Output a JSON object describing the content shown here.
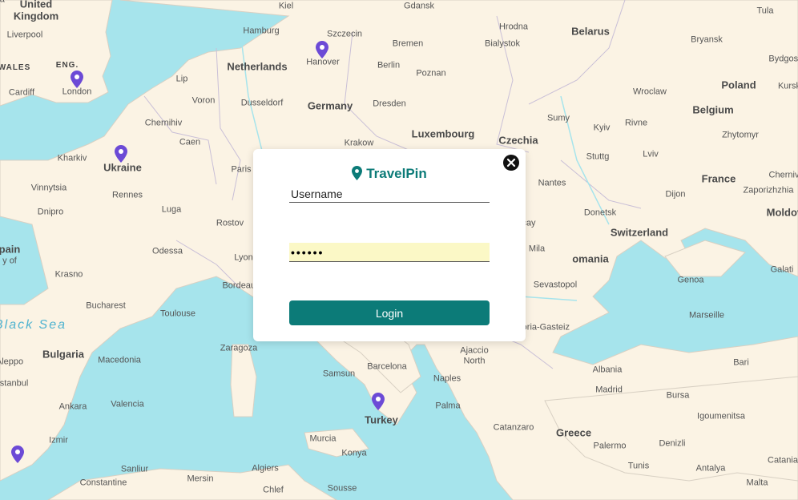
{
  "app": {
    "brand": "TravelPin",
    "accent": "#0c7b78",
    "pin_color": "#6c4ad6"
  },
  "login": {
    "username_placeholder": "Username",
    "password_value": "••••••",
    "login_label": "Login"
  },
  "map": {
    "labels": [
      {
        "t": "United",
        "k": "country"
      },
      {
        "t": "Kingdom",
        "k": "country"
      },
      {
        "t": "Liverpool"
      },
      {
        "t": "WALES",
        "k": "small"
      },
      {
        "t": "ENG.",
        "k": "small"
      },
      {
        "t": "Cardiff"
      },
      {
        "t": "London"
      },
      {
        "t": "Kiel"
      },
      {
        "t": "Gdansk"
      },
      {
        "t": "Tula"
      },
      {
        "t": "Hrodna"
      },
      {
        "t": "Belarus",
        "k": "country"
      },
      {
        "t": "Hamburg"
      },
      {
        "t": "Szczecin"
      },
      {
        "t": "Bialystok"
      },
      {
        "t": "Bryansk"
      },
      {
        "t": "Bremen"
      },
      {
        "t": "Bydgoszcz"
      },
      {
        "t": "Lip"
      },
      {
        "t": "Netherlands",
        "k": "country"
      },
      {
        "t": "Hanover"
      },
      {
        "t": "Berlin"
      },
      {
        "t": "Poznan"
      },
      {
        "t": "Poland",
        "k": "country"
      },
      {
        "t": "Kursk"
      },
      {
        "t": "Voron"
      },
      {
        "t": "Dusseldorf"
      },
      {
        "t": "Germany",
        "k": "country"
      },
      {
        "t": "Dresden"
      },
      {
        "t": "Wroclaw"
      },
      {
        "t": "Chernihiv"
      },
      {
        "t": "Belgium",
        "k": "country"
      },
      {
        "t": "Sumy"
      },
      {
        "t": "Rivne"
      },
      {
        "t": "Kyiv"
      },
      {
        "t": "Zhytomyr"
      },
      {
        "t": "Kharkiv"
      },
      {
        "t": "Caen"
      },
      {
        "t": "Luxembourg",
        "k": "country"
      },
      {
        "t": "Krakow"
      },
      {
        "t": "Czechia",
        "k": "country"
      },
      {
        "t": "Lviv"
      },
      {
        "t": "Ukraine",
        "k": "country"
      },
      {
        "t": "Paris"
      },
      {
        "t": "Stuttg"
      },
      {
        "t": "Vinnytsia"
      },
      {
        "t": "Rennes"
      },
      {
        "t": "France",
        "k": "country"
      },
      {
        "t": "Chernivtsi"
      },
      {
        "t": "Dnipro"
      },
      {
        "t": "Luga"
      },
      {
        "t": "Nantes"
      },
      {
        "t": "Dijon"
      },
      {
        "t": "Zaporizhzhia"
      },
      {
        "t": "Donetsk"
      },
      {
        "t": "Moldova",
        "k": "country"
      },
      {
        "t": "Rostov"
      },
      {
        "t": "Switzerland",
        "k": "country"
      },
      {
        "t": "Odessa"
      },
      {
        "t": "Lyon"
      },
      {
        "t": "Mila"
      },
      {
        "t": "omania",
        "k": "country"
      },
      {
        "t": "Galati"
      },
      {
        "t": "Krasno"
      },
      {
        "t": "Bordeaux"
      },
      {
        "t": "Genoa"
      },
      {
        "t": "Sevastopol"
      },
      {
        "t": "Bucharest"
      },
      {
        "t": "Toulouse"
      },
      {
        "t": "Marseille"
      },
      {
        "t": "Black Sea",
        "k": "sea"
      },
      {
        "t": "Vitoria-Gasteiz"
      },
      {
        "t": "Bulgaria",
        "k": "country"
      },
      {
        "t": "Zaragoza"
      },
      {
        "t": "Ajaccio"
      },
      {
        "t": "North"
      },
      {
        "t": "Macedonia"
      },
      {
        "t": "Barcelona"
      },
      {
        "t": "Bari"
      },
      {
        "t": "Samsun"
      },
      {
        "t": "Naples"
      },
      {
        "t": "Albania"
      },
      {
        "t": "Istanbul"
      },
      {
        "t": "Madrid"
      },
      {
        "t": "Bursa"
      },
      {
        "t": "Ankara"
      },
      {
        "t": "Valencia"
      },
      {
        "t": "Palma"
      },
      {
        "t": "Igoumenitsa"
      },
      {
        "t": "Turkey",
        "k": "country"
      },
      {
        "t": "Catanzaro"
      },
      {
        "t": "Greece",
        "k": "country"
      },
      {
        "t": "Izmir"
      },
      {
        "t": "Murcia"
      },
      {
        "t": "Palermo"
      },
      {
        "t": "Denizli"
      },
      {
        "t": "Konya"
      },
      {
        "t": "Catania"
      },
      {
        "t": "Sanliur"
      },
      {
        "t": "Algiers"
      },
      {
        "t": "Tunis"
      },
      {
        "t": "Antalya"
      },
      {
        "t": "Mersin"
      },
      {
        "t": "Constantine"
      },
      {
        "t": "Chlef"
      },
      {
        "t": "Sousse"
      },
      {
        "t": "Malta"
      },
      {
        "t": "Aleppo"
      },
      {
        "t": "pain",
        "k": "country"
      },
      {
        "t": "y of"
      },
      {
        "t": "cay"
      },
      {
        "t": "ca"
      }
    ],
    "pins": [
      {
        "name": "london"
      },
      {
        "name": "paris"
      },
      {
        "name": "berlin"
      },
      {
        "name": "catanzaro"
      },
      {
        "name": "spain-south"
      }
    ]
  }
}
